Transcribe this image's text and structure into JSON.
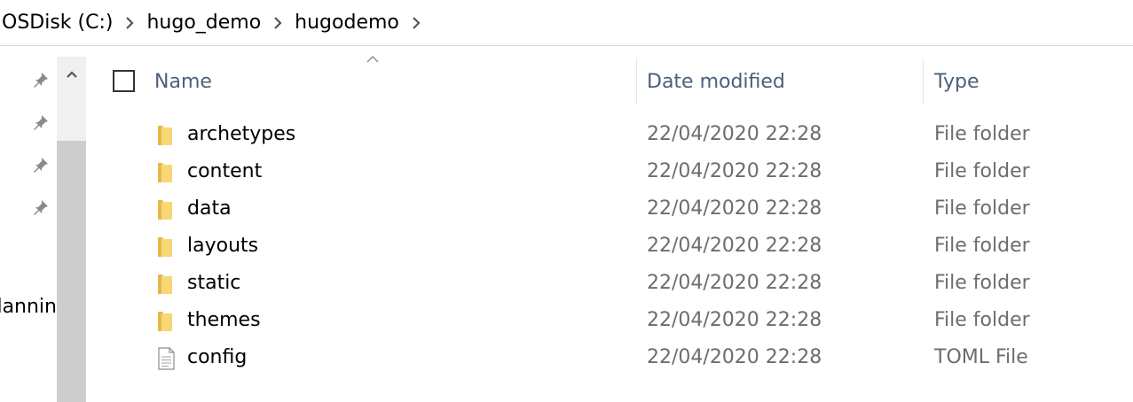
{
  "breadcrumb": [
    "OSDisk (C:)",
    "hugo_demo",
    "hugodemo"
  ],
  "nav": {
    "pins": [
      "pin-icon",
      "pin-icon",
      "pin-icon",
      "pin-icon"
    ],
    "partial_label": "lannin"
  },
  "columns": {
    "name": "Name",
    "date": "Date modified",
    "type": "Type"
  },
  "files": [
    {
      "name": "archetypes",
      "date": "22/04/2020 22:28",
      "type": "File folder",
      "icon": "folder-icon"
    },
    {
      "name": "content",
      "date": "22/04/2020 22:28",
      "type": "File folder",
      "icon": "folder-icon"
    },
    {
      "name": "data",
      "date": "22/04/2020 22:28",
      "type": "File folder",
      "icon": "folder-icon"
    },
    {
      "name": "layouts",
      "date": "22/04/2020 22:28",
      "type": "File folder",
      "icon": "folder-icon"
    },
    {
      "name": "static",
      "date": "22/04/2020 22:28",
      "type": "File folder",
      "icon": "folder-icon"
    },
    {
      "name": "themes",
      "date": "22/04/2020 22:28",
      "type": "File folder",
      "icon": "folder-icon"
    },
    {
      "name": "config",
      "date": "22/04/2020 22:28",
      "type": "TOML File",
      "icon": "document-icon"
    }
  ],
  "colors": {
    "header_text": "#4c607a",
    "meta_text": "#6d6d6d",
    "folder": "#f8d775",
    "folder_dark": "#e6b84a"
  }
}
